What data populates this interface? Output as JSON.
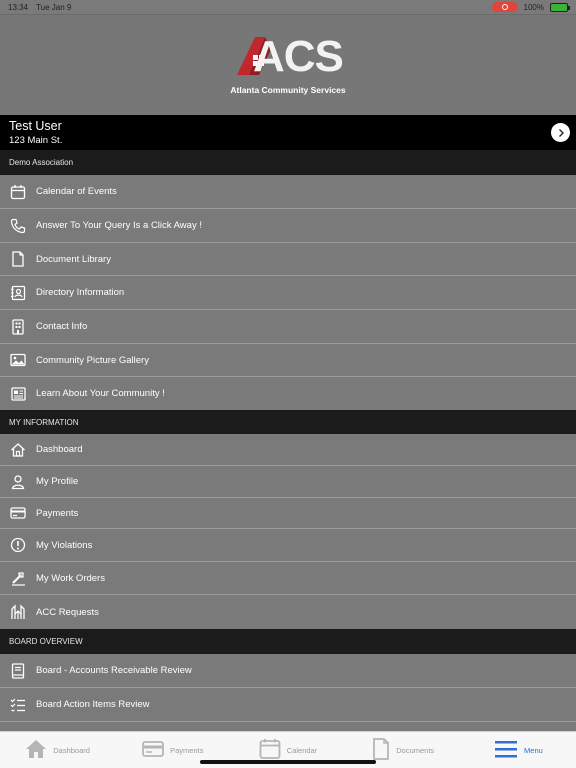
{
  "status_bar": {
    "time": "13:34",
    "date": "Tue Jan 9",
    "battery": "100%"
  },
  "logo": {
    "main": "ACS",
    "sub": "Atlanta Community Services"
  },
  "user": {
    "name": "Test User",
    "address": "123 Main St."
  },
  "sections": [
    {
      "title": "Demo Association",
      "items": [
        {
          "label": "Calendar of Events",
          "icon": "calendar-icon"
        },
        {
          "label": "Answer To Your Query Is a Click Away !",
          "icon": "phone-icon"
        },
        {
          "label": "Document Library",
          "icon": "document-icon"
        },
        {
          "label": "Directory Information",
          "icon": "contact-card-icon"
        },
        {
          "label": "Contact Info",
          "icon": "building-icon"
        },
        {
          "label": "Community Picture Gallery",
          "icon": "image-icon"
        },
        {
          "label": "Learn About Your Community !",
          "icon": "newspaper-icon"
        }
      ]
    },
    {
      "title": "MY INFORMATION",
      "items": [
        {
          "label": "Dashboard",
          "icon": "home-icon"
        },
        {
          "label": "My Profile",
          "icon": "person-icon"
        },
        {
          "label": "Payments",
          "icon": "credit-card-icon"
        },
        {
          "label": "My Violations",
          "icon": "alert-circle-icon"
        },
        {
          "label": "My Work Orders",
          "icon": "wrench-icon"
        },
        {
          "label": "ACC Requests",
          "icon": "architecture-icon"
        }
      ]
    },
    {
      "title": "BOARD OVERVIEW",
      "items": [
        {
          "label": "Board - Accounts Receivable Review",
          "icon": "ledger-book-icon"
        },
        {
          "label": "Board Action Items Review",
          "icon": "checklist-icon"
        }
      ]
    }
  ],
  "tabs": [
    {
      "label": "Dashboard",
      "icon": "home-icon",
      "active": false
    },
    {
      "label": "Payments",
      "icon": "credit-card-icon",
      "active": false
    },
    {
      "label": "Calendar",
      "icon": "calendar-icon",
      "active": false
    },
    {
      "label": "Documents",
      "icon": "document-icon",
      "active": false
    },
    {
      "label": "Menu",
      "icon": "hamburger-menu-icon",
      "active": true
    }
  ],
  "colors": {
    "accent": "#2f6fd6",
    "logo_red": "#c0282d",
    "header_dark": "#1b1b1b"
  }
}
